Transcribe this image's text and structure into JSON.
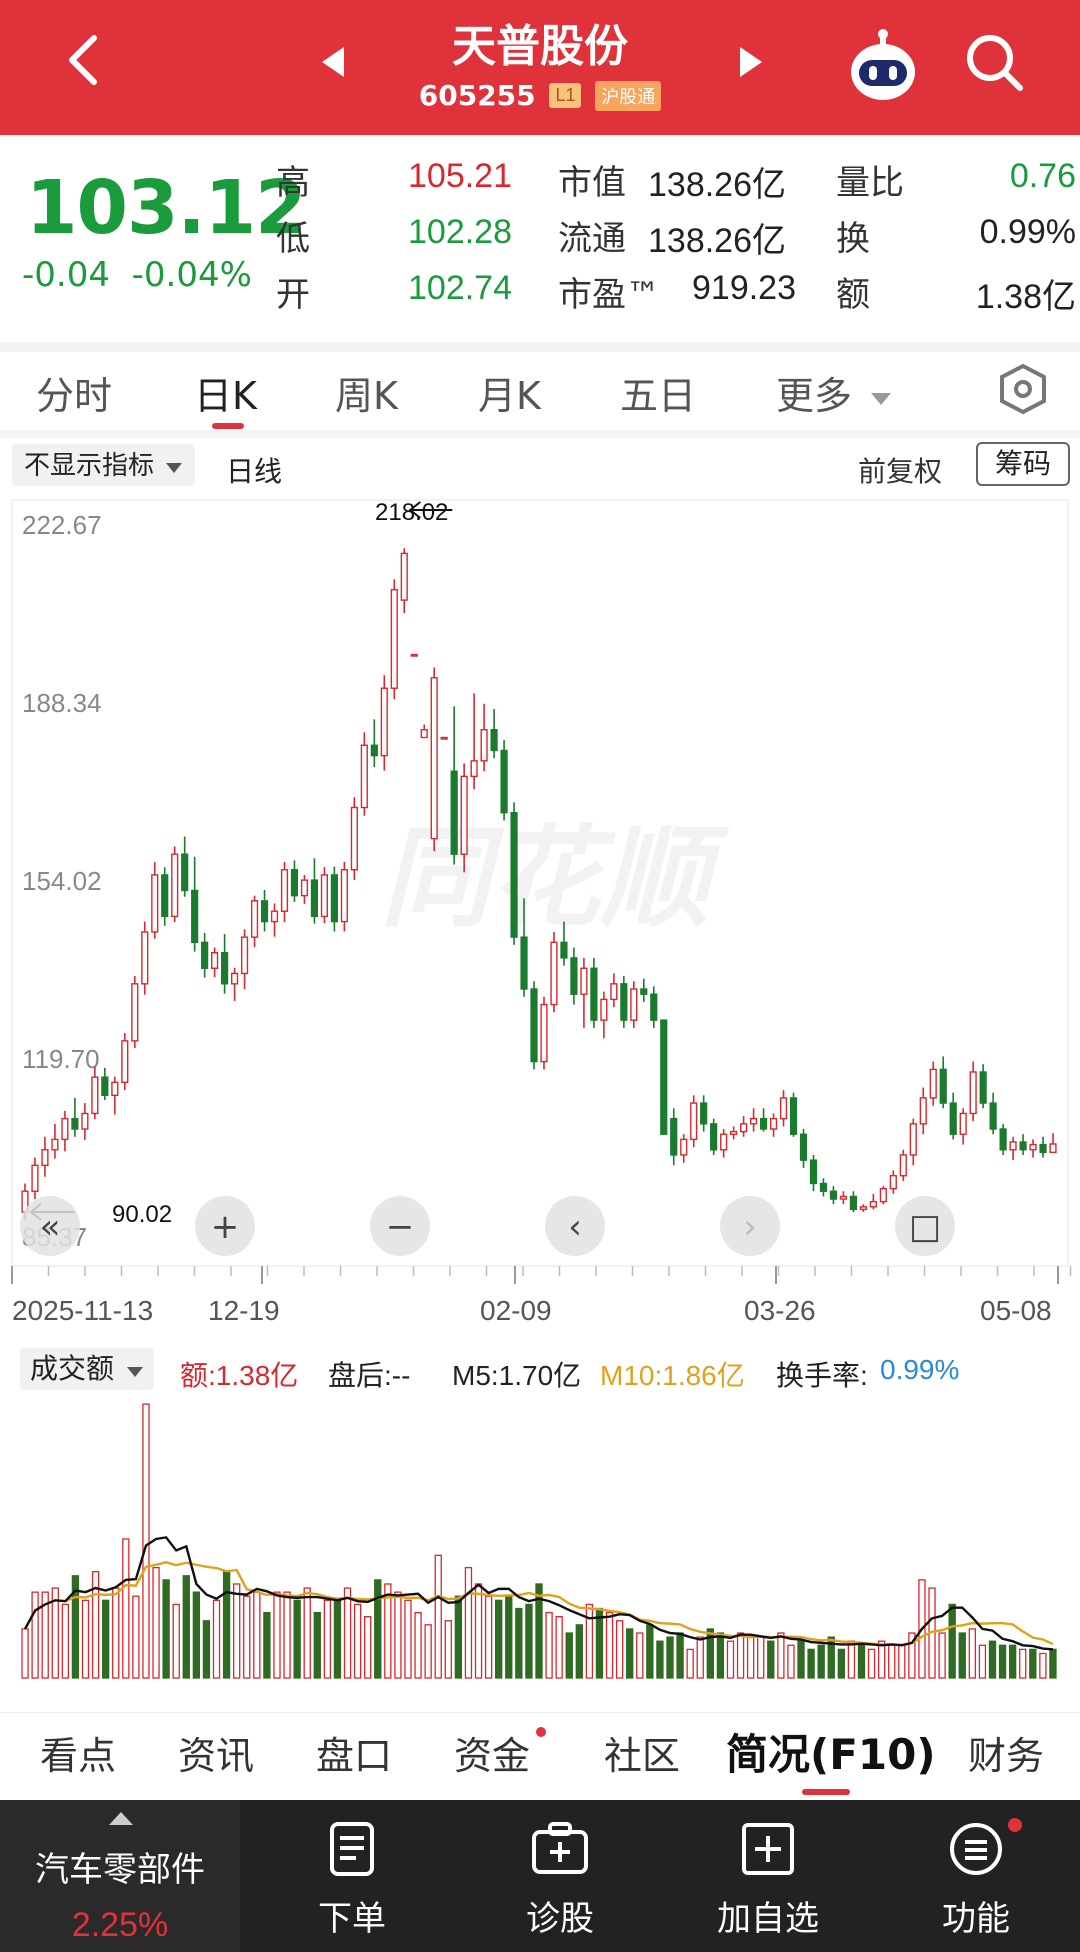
{
  "header": {
    "title": "天普股份",
    "code": "605255",
    "level_badge": "L1",
    "connect_badge": "沪股通",
    "bg_color": "#e0323b"
  },
  "quote": {
    "price": "103.12",
    "change": "-0.04",
    "change_pct": "-0.04%",
    "high_label": "高",
    "high": "105.21",
    "low_label": "低",
    "low": "102.28",
    "open_label": "开",
    "open": "102.74",
    "mktcap_label": "市值",
    "mktcap": "138.26亿",
    "float_label": "流通",
    "float": "138.26亿",
    "pe_label": "市盈™",
    "pe": "919.23",
    "vr_label": "量比",
    "vr": "0.76",
    "turnover_label": "换",
    "turnover": "0.99%",
    "amount_label": "额",
    "amount": "1.38亿"
  },
  "tabs": [
    "分时",
    "日K",
    "周K",
    "月K",
    "五日",
    "更多"
  ],
  "active_tab": "日K",
  "subbar": {
    "indicator": "不显示指标",
    "period": "日线",
    "adjust": "前复权",
    "chip": "筹码"
  },
  "chart_data": [
    {
      "type": "candlestick",
      "title": "日线",
      "y_ticks": [
        "222.67",
        "188.34",
        "154.02",
        "119.70",
        "85.37"
      ],
      "ylim": [
        85.37,
        222.67
      ],
      "x_ticks": [
        "2025-11-13",
        "12-19",
        "02-09",
        "03-26",
        "05-08"
      ],
      "annotations": [
        {
          "label": "218.02",
          "type": "max"
        },
        {
          "label": "90.02",
          "type": "min"
        }
      ],
      "watermark": "同花顺",
      "controls": [
        "«",
        "+",
        "−",
        "‹",
        "›",
        "□"
      ],
      "up_color": "#d9272e",
      "down_color": "#1a7a2e",
      "candles": [
        [
          90.0,
          95.5,
          88.5,
          94.0
        ],
        [
          94.0,
          100.5,
          92.5,
          99.0
        ],
        [
          99.0,
          104.5,
          96.8,
          102.0
        ],
        [
          102.0,
          107.0,
          100.3,
          104.0
        ],
        [
          104.0,
          109.5,
          101.7,
          108.0
        ],
        [
          108.0,
          112.0,
          104.5,
          106.0
        ],
        [
          106.0,
          111.0,
          103.9,
          109.0
        ],
        [
          109.0,
          118.0,
          107.9,
          116.0
        ],
        [
          116.0,
          117.8,
          111.6,
          112.5
        ],
        [
          112.5,
          116.1,
          108.8,
          115.0
        ],
        [
          115.0,
          124.5,
          113.5,
          123.0
        ],
        [
          123.0,
          135.5,
          121.6,
          134.0
        ],
        [
          134.0,
          146.0,
          131.9,
          144.0
        ],
        [
          144.0,
          157.5,
          142.7,
          155.0
        ],
        [
          155.0,
          156.5,
          145.2,
          147.0
        ],
        [
          147.0,
          160.5,
          145.9,
          159.0
        ],
        [
          159.0,
          162.4,
          150.8,
          152.0
        ],
        [
          152.0,
          158.5,
          140.2,
          142.0
        ],
        [
          142.0,
          143.8,
          135.2,
          137.0
        ],
        [
          137.0,
          141.0,
          135.3,
          140.0
        ],
        [
          140.0,
          143.6,
          132.1,
          134.0
        ],
        [
          134.0,
          137.1,
          130.7,
          136.0
        ],
        [
          136.0,
          144.5,
          133.0,
          143.0
        ],
        [
          143.0,
          151.0,
          141.1,
          150.0
        ],
        [
          150.0,
          152.1,
          144.1,
          146.0
        ],
        [
          146.0,
          149.5,
          143.1,
          148.0
        ],
        [
          148.0,
          157.5,
          145.9,
          156.0
        ],
        [
          156.0,
          157.8,
          149.8,
          151.0
        ],
        [
          151.0,
          155.0,
          149.4,
          154.0
        ],
        [
          154.0,
          158.2,
          145.6,
          147.0
        ],
        [
          147.0,
          156.5,
          145.7,
          155.0
        ],
        [
          155.0,
          156.6,
          144.1,
          146.0
        ],
        [
          146.0,
          157.5,
          144.1,
          156.0
        ],
        [
          156.0,
          170.0,
          154.0,
          168.0
        ],
        [
          168.0,
          182.5,
          166.4,
          180.0
        ],
        [
          180.0,
          185.0,
          175.8,
          178.0
        ],
        [
          178.0,
          193.5,
          175.1,
          191.0
        ],
        [
          191.0,
          212.0,
          188.9,
          210.0
        ],
        [
          208.0,
          218.0,
          205.5,
          217.0
        ],
        [
          197.5,
          197.5,
          197.5,
          197.5
        ],
        [
          181.5,
          184.0,
          181.5,
          183.0
        ],
        [
          162.0,
          195.0,
          159.6,
          193.0
        ],
        [
          181.5,
          181.5,
          181.5,
          181.5
        ],
        [
          175.0,
          187.5,
          157.0,
          159.0
        ],
        [
          159.0,
          176.5,
          155.5,
          174.0
        ],
        [
          174.0,
          190.0,
          171.5,
          177.0
        ],
        [
          177.0,
          188.0,
          175.0,
          183.0
        ],
        [
          183.0,
          187.0,
          177.5,
          179.0
        ],
        [
          179.0,
          181.0,
          165.5,
          167.0
        ],
        [
          167.0,
          169.0,
          141.5,
          143.0
        ],
        [
          143.0,
          150.5,
          131.5,
          133.0
        ],
        [
          133.0,
          134.5,
          117.5,
          119.0
        ],
        [
          119.0,
          131.5,
          117.5,
          130.0
        ],
        [
          130.0,
          144.0,
          128.5,
          142.0
        ],
        [
          142.0,
          146.0,
          137.5,
          139.0
        ],
        [
          139.0,
          141.0,
          130.0,
          132.0
        ],
        [
          132.0,
          139.0,
          125.5,
          137.0
        ],
        [
          137.0,
          139.0,
          125.5,
          127.0
        ],
        [
          127.0,
          132.5,
          123.5,
          131.0
        ],
        [
          131.0,
          136.0,
          129.5,
          134.0
        ],
        [
          134.0,
          135.5,
          125.5,
          127.0
        ],
        [
          127.0,
          134.5,
          125.5,
          133.0
        ],
        [
          133.0,
          135.0,
          130.5,
          132.0
        ],
        [
          132.0,
          133.5,
          125.5,
          127.0
        ],
        [
          127.0,
          122.0,
          115.0,
          105.0
        ],
        [
          108.0,
          110.0,
          99.0,
          101.0
        ],
        [
          101.0,
          105.0,
          99.5,
          104.0
        ],
        [
          104.0,
          112.5,
          102.5,
          111.0
        ],
        [
          111.0,
          112.5,
          105.5,
          107.0
        ],
        [
          107.0,
          108.0,
          101.0,
          102.0
        ],
        [
          102.0,
          106.0,
          100.5,
          105.0
        ],
        [
          105.0,
          106.5,
          104.0,
          105.5
        ],
        [
          105.5,
          108.5,
          104.5,
          107.0
        ],
        [
          107.0,
          110.0,
          105.5,
          108.0
        ],
        [
          108.0,
          110.0,
          105.5,
          106.0
        ],
        [
          106.0,
          109.0,
          104.5,
          108.0
        ],
        [
          108.0,
          113.5,
          106.5,
          112.0
        ],
        [
          112.0,
          113.0,
          104.5,
          105.0
        ],
        [
          105.0,
          106.0,
          98.5,
          100.0
        ],
        [
          100.0,
          101.0,
          94.0,
          95.5
        ],
        [
          95.5,
          96.5,
          93.0,
          94.0
        ],
        [
          94.0,
          95.0,
          91.5,
          92.5
        ],
        [
          92.5,
          94.0,
          91.5,
          93.0
        ],
        [
          93.0,
          94.0,
          90.0,
          90.5
        ],
        [
          90.5,
          91.5,
          90.0,
          91.0
        ],
        [
          91.0,
          93.5,
          90.5,
          92.0
        ],
        [
          92.0,
          95.0,
          91.5,
          94.5
        ],
        [
          94.5,
          98.0,
          93.5,
          97.0
        ],
        [
          97.0,
          102.0,
          96.0,
          101.0
        ],
        [
          101.0,
          108.0,
          99.0,
          107.0
        ],
        [
          107.0,
          114.0,
          105.0,
          112.0
        ],
        [
          112.0,
          119.0,
          110.5,
          117.5
        ],
        [
          117.5,
          120.0,
          110.0,
          111.0
        ],
        [
          111.0,
          113.0,
          104.0,
          105.0
        ],
        [
          105.0,
          110.0,
          103.0,
          109.0
        ],
        [
          109.0,
          119.0,
          107.5,
          117.0
        ],
        [
          117.0,
          118.5,
          110.0,
          111.0
        ],
        [
          111.0,
          113.0,
          105.0,
          106.0
        ],
        [
          106.0,
          107.0,
          101.0,
          102.0
        ],
        [
          102.0,
          104.5,
          100.0,
          103.5
        ],
        [
          103.5,
          105.0,
          101.0,
          102.0
        ],
        [
          102.0,
          104.0,
          100.5,
          103.0
        ],
        [
          103.0,
          104.5,
          100.5,
          101.5
        ],
        [
          101.5,
          105.2,
          102.3,
          103.12
        ]
      ]
    },
    {
      "type": "bar",
      "title": "成交额",
      "legend": {
        "amount": "额:1.38亿",
        "after": "盘后:--",
        "m5": "M5:1.70亿",
        "m10": "M10:1.86亿",
        "turnover_label": "换手率:",
        "turnover": "0.99%"
      },
      "colors": {
        "up": "#d9272e",
        "down": "#2f6b23",
        "m5": "#111111",
        "m10": "#e0a21a",
        "turnover": "#2a8ad4"
      },
      "values": [
        1.2,
        2.1,
        2.1,
        2.2,
        1.8,
        2.5,
        1.9,
        2.6,
        1.9,
        2.2,
        3.4,
        2.0,
        6.7,
        2.7,
        2.4,
        1.8,
        2.5,
        2.1,
        1.4,
        1.9,
        2.6,
        2.3,
        2.0,
        2.1,
        1.6,
        2.1,
        2.1,
        1.9,
        2.2,
        1.6,
        1.9,
        1.9,
        2.2,
        1.8,
        1.5,
        2.4,
        2.3,
        2.1,
        1.9,
        1.6,
        1.3,
        3.0,
        1.4,
        2.0,
        2.7,
        2.3,
        2.0,
        1.9,
        2.0,
        1.7,
        1.8,
        2.3,
        1.6,
        1.5,
        1.1,
        1.3,
        1.8,
        1.7,
        1.6,
        1.4,
        1.2,
        1.1,
        1.3,
        0.9,
        1.0,
        1.1,
        0.7,
        1.0,
        1.2,
        1.1,
        0.9,
        1.1,
        1.0,
        1.0,
        0.9,
        1.1,
        0.8,
        0.9,
        0.7,
        0.8,
        1.0,
        0.7,
        0.9,
        0.8,
        0.7,
        0.9,
        0.8,
        0.8,
        1.1,
        2.4,
        2.2,
        1.1,
        1.8,
        1.1,
        1.2,
        0.8,
        0.9,
        0.8,
        0.8,
        0.7,
        0.7,
        0.6,
        0.7
      ]
    }
  ],
  "bottom_tabs": [
    "看点",
    "资讯",
    "盘口",
    "资金",
    "社区",
    "简况(F10)",
    "财务"
  ],
  "bottom_active": "简况(F10)",
  "footer": {
    "sector_name": "汽车零部件",
    "sector_pct": "2.25%",
    "buttons": [
      "下单",
      "诊股",
      "加自选",
      "功能"
    ]
  }
}
